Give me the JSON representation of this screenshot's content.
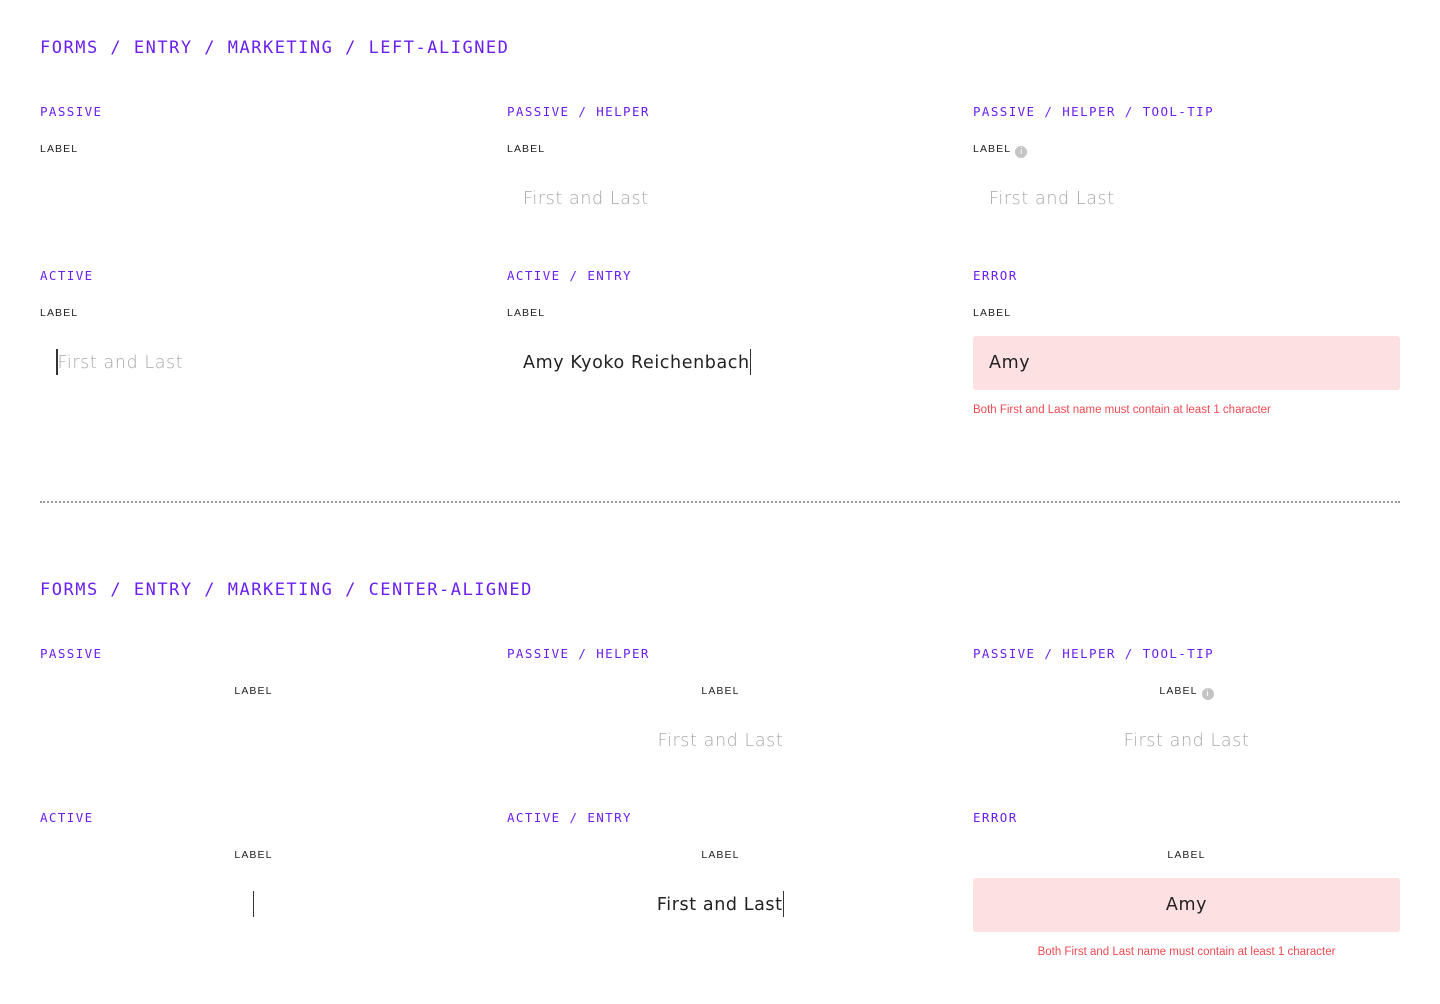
{
  "sections": [
    {
      "title": "FORMS / ENTRY / MARKETING / LEFT-ALIGNED",
      "states": {
        "passive": {
          "title": "PASSIVE",
          "label": "LABEL"
        },
        "passive_helper": {
          "title": "PASSIVE / HELPER",
          "label": "LABEL",
          "placeholder": "First and Last"
        },
        "passive_helper_tooltip": {
          "title": "PASSIVE / HELPER / TOOL-TIP",
          "label": "LABEL",
          "placeholder": "First and Last",
          "tooltip_icon": "i"
        },
        "active": {
          "title": "ACTIVE",
          "label": "LABEL",
          "placeholder": "First and Last"
        },
        "active_entry": {
          "title": "ACTIVE / ENTRY",
          "label": "LABEL",
          "value": "Amy Kyoko Reichenbach"
        },
        "error": {
          "title": "ERROR",
          "label": "LABEL",
          "value": "Amy",
          "message": "Both First and Last name must contain at least 1 character"
        }
      }
    },
    {
      "title": "FORMS / ENTRY / MARKETING / CENTER-ALIGNED",
      "states": {
        "passive": {
          "title": "PASSIVE",
          "label": "LABEL"
        },
        "passive_helper": {
          "title": "PASSIVE / HELPER",
          "label": "LABEL",
          "placeholder": "First and Last"
        },
        "passive_helper_tooltip": {
          "title": "PASSIVE / HELPER / TOOL-TIP",
          "label": "LABEL",
          "placeholder": "First and Last",
          "tooltip_icon": "i"
        },
        "active": {
          "title": "ACTIVE",
          "label": "LABEL"
        },
        "active_entry": {
          "title": "ACTIVE / ENTRY",
          "label": "LABEL",
          "value": "First and Last"
        },
        "error": {
          "title": "ERROR",
          "label": "LABEL",
          "value": "Amy",
          "message": "Both First and Last name must contain at least 1 character"
        }
      }
    }
  ],
  "colors": {
    "accent": "#6b1ff0",
    "error_text": "#ef4a52",
    "error_fill": "#fde0e1",
    "placeholder": "#a8a8a8",
    "text": "#222222"
  }
}
